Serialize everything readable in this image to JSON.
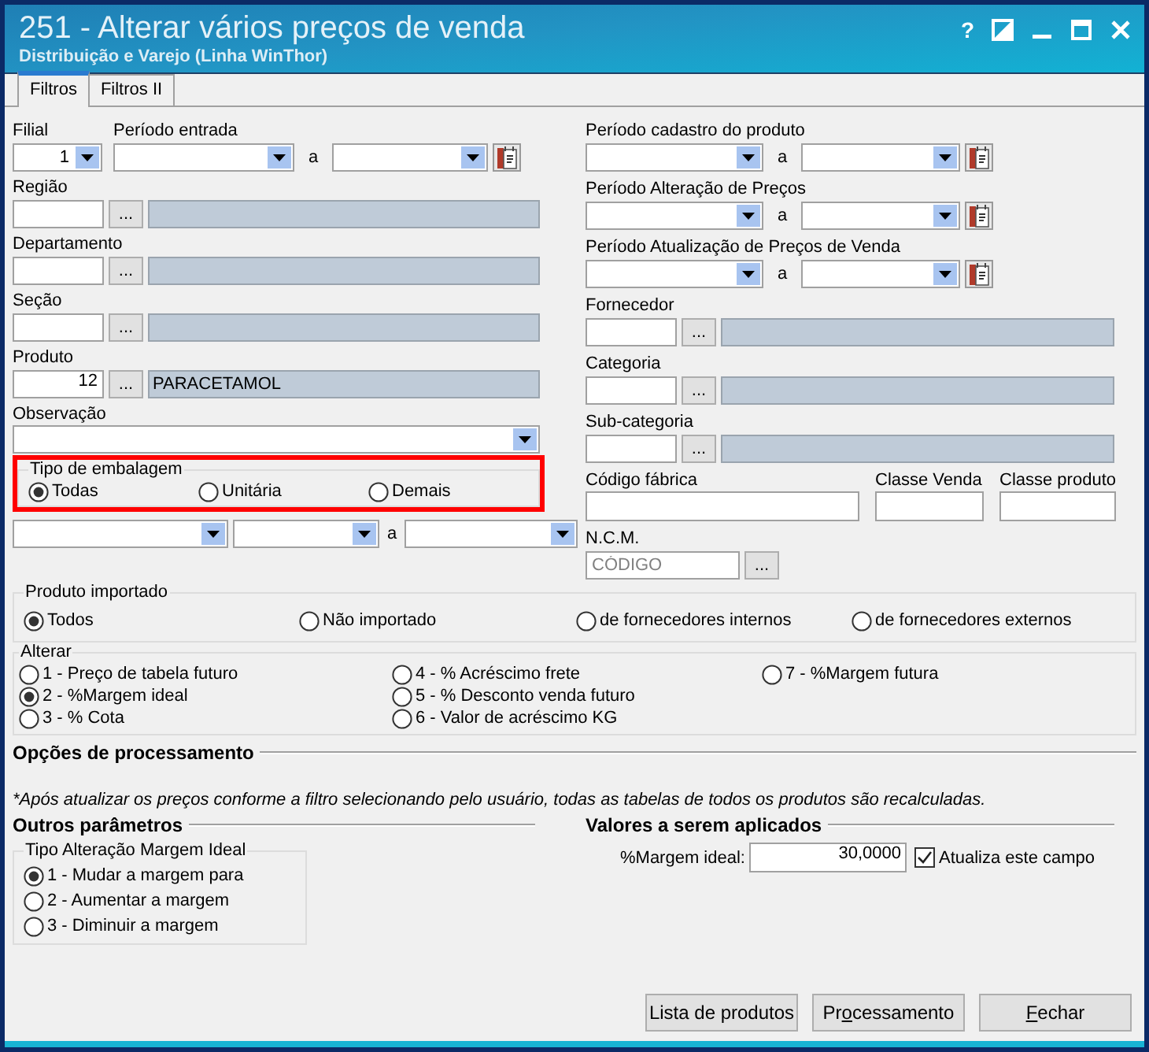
{
  "window": {
    "title": "251 - Alterar vários preços de venda",
    "subtitle": "Distribuição e Varejo (Linha WinThor)",
    "help": "?"
  },
  "tabs": [
    {
      "label": "Filtros",
      "selected": true
    },
    {
      "label": "Filtros II",
      "selected": false
    }
  ],
  "left_filters": {
    "filial": {
      "label": "Filial",
      "value": "1"
    },
    "periodo_entrada": {
      "label": "Período entrada",
      "separator": "a"
    },
    "lookups": [
      {
        "label": "Região",
        "button": "..."
      },
      {
        "label": "Departamento",
        "button": "..."
      },
      {
        "label": "Seção",
        "button": "..."
      },
      {
        "label": "Produto",
        "button": "...",
        "code": "12",
        "description": "PARACETAMOL"
      }
    ],
    "observacao": {
      "label": "Observação"
    },
    "tipo_embalagem": {
      "title": "Tipo de embalagem",
      "highlighted": true,
      "options": [
        {
          "label": "Todas",
          "selected": true
        },
        {
          "label": "Unitária",
          "selected": false
        },
        {
          "label": "Demais",
          "selected": false
        }
      ]
    },
    "range_row": {
      "separator": "a"
    }
  },
  "right_filters": {
    "periods": [
      {
        "label": "Período cadastro do produto",
        "separator": "a"
      },
      {
        "label": "Período Alteração de Preços",
        "separator": "a"
      },
      {
        "label": "Período Atualização de Preços de Venda",
        "separator": "a"
      }
    ],
    "lookups": [
      {
        "label": "Fornecedor",
        "button": "..."
      },
      {
        "label": "Categoria",
        "button": "..."
      },
      {
        "label": "Sub-categoria",
        "button": "..."
      }
    ],
    "fields": [
      {
        "label": "Código fábrica"
      },
      {
        "label": "Classe Venda"
      },
      {
        "label": "Classe produto"
      }
    ],
    "ncm": {
      "label": "N.C.M.",
      "placeholder": "CÓDIGO",
      "button": "..."
    }
  },
  "produto_importado": {
    "title": "Produto importado",
    "options": [
      {
        "label": "Todos",
        "selected": true
      },
      {
        "label": "Não importado",
        "selected": false
      },
      {
        "label": "de fornecedores internos",
        "selected": false
      },
      {
        "label": "de fornecedores externos",
        "selected": false
      }
    ]
  },
  "alterar": {
    "title": "Alterar",
    "options": [
      {
        "label": "1 - Preço de tabela futuro",
        "selected": false
      },
      {
        "label": "2 - %Margem ideal",
        "selected": true
      },
      {
        "label": "3 - % Cota",
        "selected": false
      },
      {
        "label": "4 - % Acréscimo frete",
        "selected": false
      },
      {
        "label": "5 - % Desconto venda futuro",
        "selected": false
      },
      {
        "label": "6 - Valor de acréscimo KG",
        "selected": false
      },
      {
        "label": "7 - %Margem futura",
        "selected": false
      }
    ]
  },
  "opcoes_processamento": {
    "title": "Opções de processamento",
    "note": "*Após atualizar os preços conforme a filtro selecionando pelo usuário, todas as tabelas de todos os produtos são recalculadas."
  },
  "outros_parametros": {
    "title": "Outros parâmetros",
    "group": {
      "title": "Tipo Alteração Margem Ideal",
      "options": [
        {
          "label": "1 - Mudar a margem para",
          "selected": true
        },
        {
          "label": "2 - Aumentar a margem",
          "selected": false
        },
        {
          "label": "3 - Diminuir a margem",
          "selected": false
        }
      ]
    }
  },
  "valores": {
    "title": "Valores a serem aplicados",
    "label": "%Margem ideal:",
    "value": "30,0000",
    "checkbox": {
      "label": "Atualiza este campo",
      "checked": true
    }
  },
  "buttons": [
    {
      "parts": [
        {
          "text": "Lista de produtos",
          "underlined": false
        }
      ]
    },
    {
      "parts": [
        {
          "text": "Pr",
          "underlined": false
        },
        {
          "text": "o",
          "underlined": true
        },
        {
          "text": "cessamento",
          "underlined": false
        }
      ]
    },
    {
      "parts": [
        {
          "text": "F",
          "underlined": true
        },
        {
          "text": "echar",
          "underlined": false
        }
      ]
    }
  ]
}
